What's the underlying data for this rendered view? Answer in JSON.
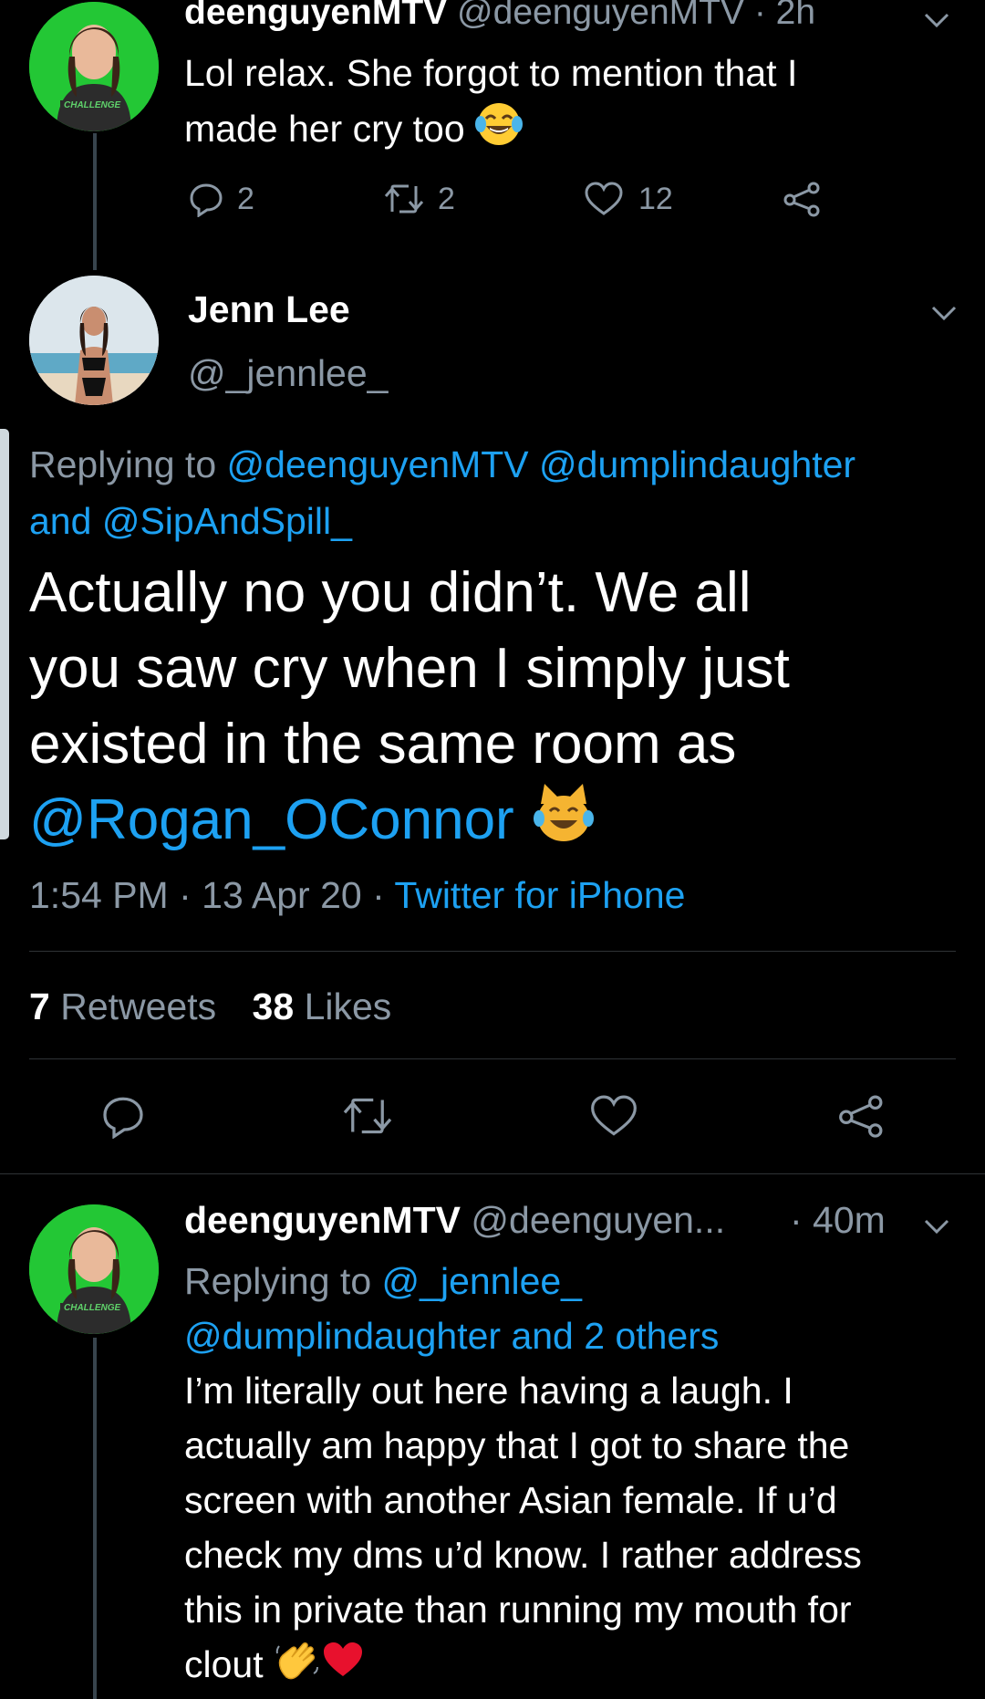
{
  "tweet1": {
    "name": "deenguyenMTV",
    "handle": "@deenguyenMTV",
    "time": "· 2h",
    "text_line1": "Lol relax. She forgot to mention that I",
    "text_line2": "made her cry too",
    "emoji": "tears-of-joy",
    "replies": "2",
    "retweets": "2",
    "likes": "12",
    "avatar_badge": "CHALLENGE"
  },
  "main_tweet": {
    "name": "Jenn Lee",
    "handle": "@_jennlee_",
    "replying_prefix": "Replying to",
    "reply_mention1": "@deenguyenMTV",
    "reply_mention2": "@dumplindaughter",
    "reply_and": "and",
    "reply_mention3": "@SipAndSpill_",
    "text_line1": "Actually no you didn’t. We all",
    "text_line2": "you saw cry when I simply just",
    "text_line3": "existed in the same room as",
    "text_mention": "@Rogan_OConnor",
    "emoji": "cat-tears-of-joy",
    "time": "1:54 PM",
    "date": "13 Apr 20",
    "sep": "·",
    "source": "Twitter for iPhone",
    "retweets_count": "7",
    "retweets_label": "Retweets",
    "likes_count": "38",
    "likes_label": "Likes"
  },
  "tweet3": {
    "name": "deenguyenMTV",
    "handle": "@deenguyen...",
    "time": "· 40m",
    "replying_prefix": "Replying to",
    "reply_mention1": "@_jennlee_",
    "reply_line2": "@dumplindaughter and 2 others",
    "text_line1": "I’m literally out here having a laugh. I",
    "text_line2": "actually am happy that I got to share the",
    "text_line3": "screen with another Asian female. If u’d",
    "text_line4": "check my dms u’d know. I rather address",
    "text_line5": "this in private than running my mouth for",
    "text_line6": "clout",
    "emojis": [
      "waving-hand",
      "red-heart"
    ],
    "avatar_badge": "CHALLENGE"
  },
  "colors": {
    "background": "#000000",
    "text": "#ffffff",
    "secondary": "#8b98a5",
    "link": "#1da1f2",
    "divider": "#2f3336",
    "avatar_green": "#22c933"
  }
}
